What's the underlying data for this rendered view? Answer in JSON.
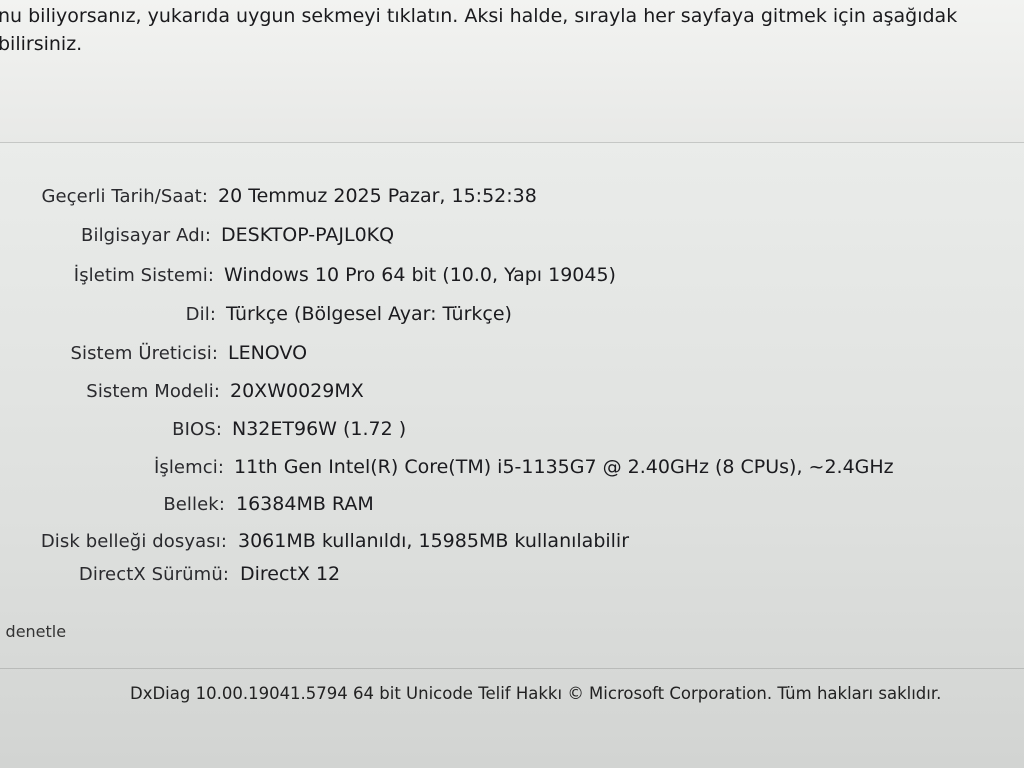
{
  "intro": {
    "line1": "nu biliyorsanız, yukarıda uygun sekmeyi tıklatın. Aksi halde, sırayla her sayfaya gitmek için aşağıdak",
    "line2": "bilirsiniz."
  },
  "system_info": [
    {
      "label": "Geçerli Tarih/Saat:",
      "value": "20 Temmuz 2025 Pazar, 15:52:38"
    },
    {
      "label": "Bilgisayar Adı:",
      "value": "DESKTOP-PAJL0KQ"
    },
    {
      "label": "İşletim Sistemi:",
      "value": "Windows 10 Pro 64 bit (10.0, Yapı 19045)"
    },
    {
      "label": "Dil:",
      "value": "Türkçe (Bölgesel Ayar: Türkçe)"
    },
    {
      "label": "Sistem Üreticisi:",
      "value": "LENOVO"
    },
    {
      "label": "Sistem Modeli:",
      "value": "20XW0029MX"
    },
    {
      "label": "BIOS:",
      "value": "N32ET96W (1.72 )"
    },
    {
      "label": "İşlemci:",
      "value": "11th Gen Intel(R) Core(TM) i5-1135G7 @ 2.40GHz (8 CPUs), ~2.4GHz"
    },
    {
      "label": "Bellek:",
      "value": "16384MB RAM"
    },
    {
      "label": "Disk belleği dosyası:",
      "value": "3061MB kullanıldı, 15985MB kullanılabilir"
    },
    {
      "label": "DirectX Sürümü:",
      "value": "DirectX 12"
    }
  ],
  "checkbox_text": "ı denetle",
  "footer": "DxDiag 10.00.19041.5794 64 bit Unicode  Telif Hakkı © Microsoft Corporation. Tüm hakları saklıdır."
}
